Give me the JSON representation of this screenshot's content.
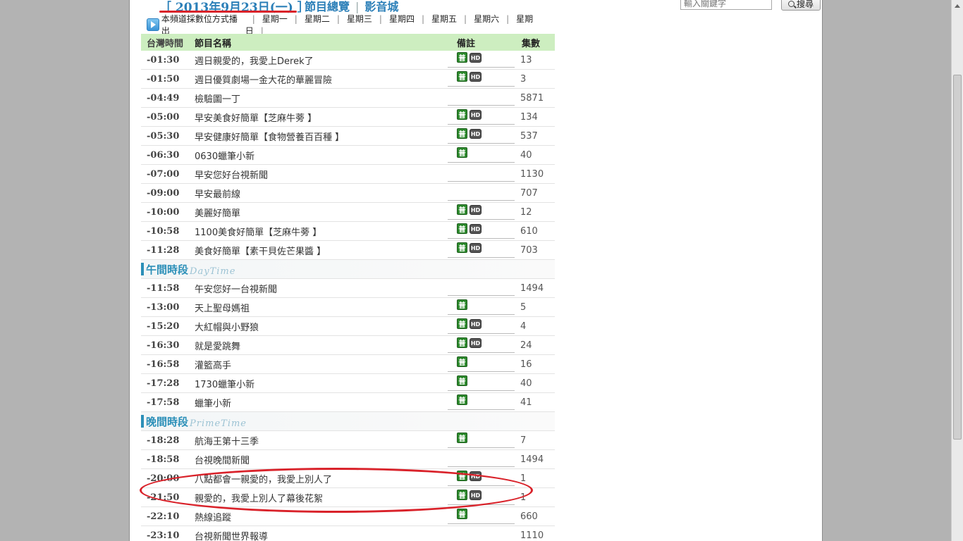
{
  "header": {
    "date_link": "［ 2013年9月23日(一) ］",
    "nav": [
      "節目總覽",
      "影音城"
    ],
    "search_placeholder": "輸入關鍵字",
    "search_button": "搜尋"
  },
  "daybar": {
    "notice": "本頻道採數位方式播出",
    "days": [
      "星期一",
      "星期二",
      "星期三",
      "星期四",
      "星期五",
      "星期六",
      "星期日"
    ]
  },
  "table": {
    "headers": [
      "台灣時間",
      "節目名稱",
      "備註",
      "集數"
    ],
    "groups": [
      {
        "section": null,
        "rows": [
          {
            "time": "-01:30",
            "name": "週日親愛的，我愛上Derek了",
            "pu": true,
            "hd": true,
            "ep": "13"
          },
          {
            "time": "-01:50",
            "name": "週日優質劇場一金大花的華麗冒險",
            "pu": true,
            "hd": true,
            "ep": "3"
          },
          {
            "time": "-04:49",
            "name": "檢驗圖一丁",
            "pu": false,
            "hd": false,
            "ep": "5871"
          },
          {
            "time": "-05:00",
            "name": "早安美食好簡單【芝麻牛蒡 】",
            "pu": true,
            "hd": true,
            "ep": "134"
          },
          {
            "time": "-05:30",
            "name": "早安健康好簡單【食物營養百百種 】",
            "pu": true,
            "hd": true,
            "ep": "537"
          },
          {
            "time": "-06:30",
            "name": "0630蠟筆小新",
            "pu": true,
            "hd": false,
            "ep": "40"
          },
          {
            "time": "-07:00",
            "name": "早安您好台視新聞",
            "pu": false,
            "hd": false,
            "ep": "1130"
          },
          {
            "time": "-09:00",
            "name": "早安最前線",
            "pu": false,
            "hd": false,
            "ep": "707"
          },
          {
            "time": "-10:00",
            "name": "美麗好簡單",
            "pu": true,
            "hd": true,
            "ep": "12"
          },
          {
            "time": "-10:58",
            "name": "1100美食好簡單【芝麻牛蒡 】",
            "pu": true,
            "hd": true,
            "ep": "610"
          },
          {
            "time": "-11:28",
            "name": "美食好簡單【素干貝佐芒果醬 】",
            "pu": true,
            "hd": true,
            "ep": "703"
          }
        ]
      },
      {
        "section": {
          "title": "午間時段",
          "eng": "DayTime"
        },
        "rows": [
          {
            "time": "-11:58",
            "name": "午安您好一台視新聞",
            "pu": false,
            "hd": false,
            "ep": "1494"
          },
          {
            "time": "-13:00",
            "name": "天上聖母媽祖",
            "pu": true,
            "hd": false,
            "ep": "5"
          },
          {
            "time": "-15:20",
            "name": "大紅帽與小野狼",
            "pu": true,
            "hd": true,
            "ep": "4"
          },
          {
            "time": "-16:30",
            "name": "就是愛跳舞",
            "pu": true,
            "hd": true,
            "ep": "24"
          },
          {
            "time": "-16:58",
            "name": "灌籃高手",
            "pu": true,
            "hd": false,
            "ep": "16"
          },
          {
            "time": "-17:28",
            "name": "1730蠟筆小新",
            "pu": true,
            "hd": false,
            "ep": "40"
          },
          {
            "time": "-17:58",
            "name": "蠟筆小新",
            "pu": true,
            "hd": false,
            "ep": "41"
          }
        ]
      },
      {
        "section": {
          "title": "晚間時段",
          "eng": "PrimeTime"
        },
        "rows": [
          {
            "time": "-18:28",
            "name": "航海王第十三季",
            "pu": true,
            "hd": false,
            "ep": "7"
          },
          {
            "time": "-18:58",
            "name": "台視晚間新聞",
            "pu": false,
            "hd": false,
            "ep": "1494"
          },
          {
            "time": "-20:00",
            "name": "八點都會一親愛的，我愛上別人了",
            "pu": true,
            "hd": true,
            "ep": "1"
          },
          {
            "time": "-21:50",
            "name": "親愛的，我愛上別人了幕後花絮",
            "pu": true,
            "hd": true,
            "ep": "1"
          },
          {
            "time": "-22:10",
            "name": "熱線追蹤",
            "pu": true,
            "hd": false,
            "ep": "660"
          },
          {
            "time": "-23:10",
            "name": "台視新聞世界報導",
            "pu": false,
            "hd": false,
            "ep": "1110"
          }
        ]
      }
    ]
  },
  "badges": {
    "pu": "普",
    "hd": "HD"
  },
  "colors": {
    "accent": "#2b7fb8",
    "header_bg": "#cdeec0",
    "annotation": "#d9222a"
  }
}
